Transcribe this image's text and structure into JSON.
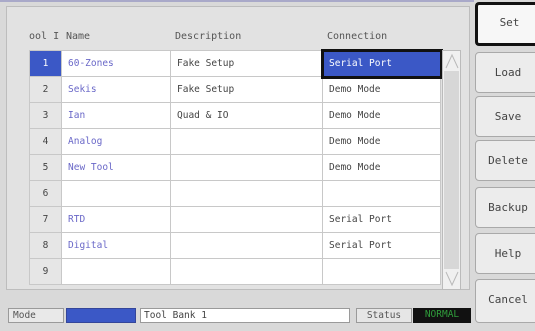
{
  "table": {
    "headers": {
      "index": "ool I",
      "name": "Name",
      "description": "Description",
      "connection": "Connection"
    },
    "rows": [
      {
        "index": "1",
        "name": "60-Zones",
        "description": "Fake Setup",
        "connection": "Serial Port",
        "selected": true
      },
      {
        "index": "2",
        "name": "Sekis",
        "description": "Fake Setup",
        "connection": "Demo Mode"
      },
      {
        "index": "3",
        "name": "Ian",
        "description": "Quad & IO",
        "connection": "Demo Mode"
      },
      {
        "index": "4",
        "name": "Analog",
        "description": "",
        "connection": "Demo Mode"
      },
      {
        "index": "5",
        "name": "New Tool",
        "description": "",
        "connection": "Demo Mode"
      },
      {
        "index": "6",
        "name": "",
        "description": "",
        "connection": ""
      },
      {
        "index": "7",
        "name": "RTD",
        "description": "",
        "connection": "Serial Port"
      },
      {
        "index": "8",
        "name": "Digital",
        "description": "",
        "connection": "Serial Port"
      },
      {
        "index": "9",
        "name": "",
        "description": "",
        "connection": ""
      }
    ]
  },
  "buttons": {
    "set": "Set",
    "load": "Load",
    "save": "Save",
    "delete": "Delete",
    "backup": "Backup",
    "help": "Help",
    "cancel": "Cancel"
  },
  "statusbar": {
    "mode_label": "Mode",
    "bank_text": "Tool Bank 1",
    "status_label": "Status",
    "status_value": "NORMAL"
  },
  "colors": {
    "selection": "#3b58c6",
    "name_text": "#6a68c8",
    "status_normal": "#2f9c3b"
  },
  "icons": [
    "scroll-up-arrow-icon",
    "scroll-down-arrow-icon"
  ]
}
